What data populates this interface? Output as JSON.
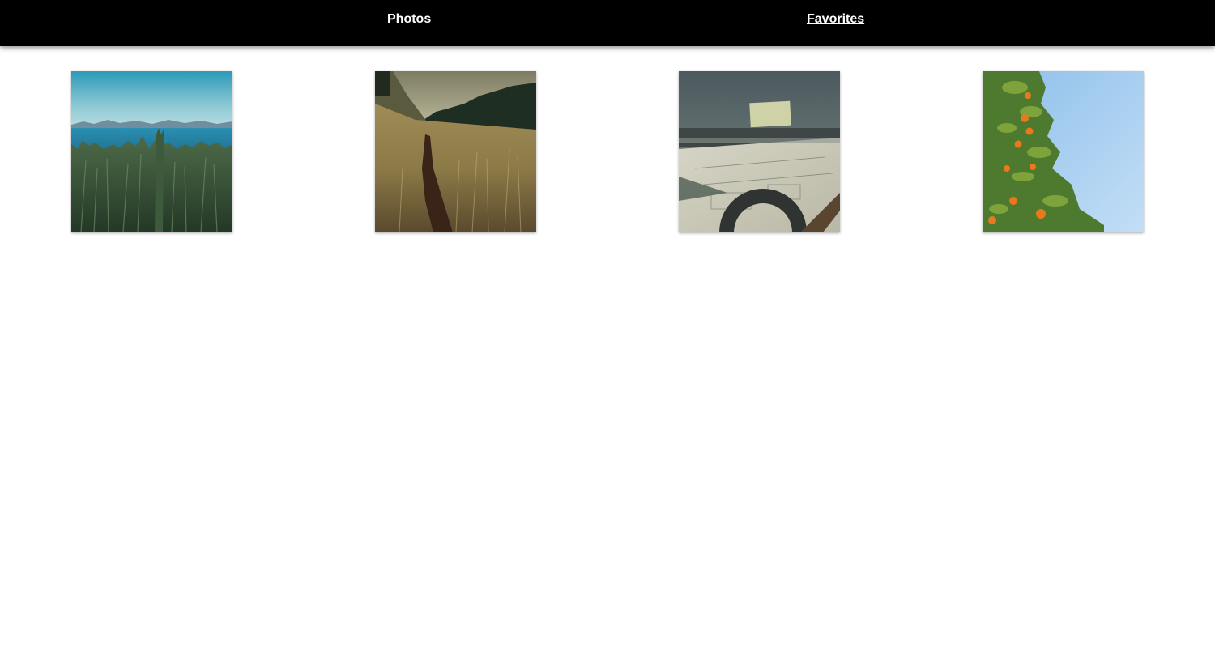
{
  "nav": {
    "photos_label": "Photos",
    "favorites_label": "Favorites"
  },
  "photos": [
    {
      "subject": "coastal-meadow"
    },
    {
      "subject": "grassland-trail"
    },
    {
      "subject": "drafting-desk"
    },
    {
      "subject": "orange-tree"
    }
  ],
  "colors": {
    "topbar": "#000000",
    "nav_text": "#ffffff",
    "page_background": "#ffffff"
  }
}
